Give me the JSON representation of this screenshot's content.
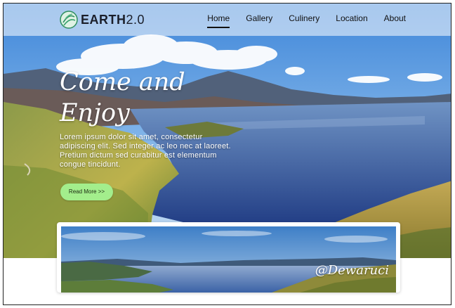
{
  "brand": {
    "name": "EARTH",
    "version": "2.0",
    "logo_icon": "earth-leaf-icon"
  },
  "nav": {
    "items": [
      {
        "label": "Home",
        "active": true
      },
      {
        "label": "Gallery",
        "active": false
      },
      {
        "label": "Culinery",
        "active": false
      },
      {
        "label": "Location",
        "active": false
      },
      {
        "label": "About",
        "active": false
      }
    ]
  },
  "hero": {
    "title_line1": "Come and",
    "title_line2": "Enjoy",
    "body": "Lorem ipsum dolor sit amet, consectetur adipiscing elit. Sed integer ac leo nec at laoreet. Pretium dictum sed curabitur est elementum congue tincidunt.",
    "cta_label": "Read More >>"
  },
  "card": {
    "credit": "@Dewaruci"
  },
  "colors": {
    "accent_button": "#a3ee8c",
    "sky": "#5c9be0",
    "lake": "#2f5ea8",
    "nav_text": "#111111"
  }
}
